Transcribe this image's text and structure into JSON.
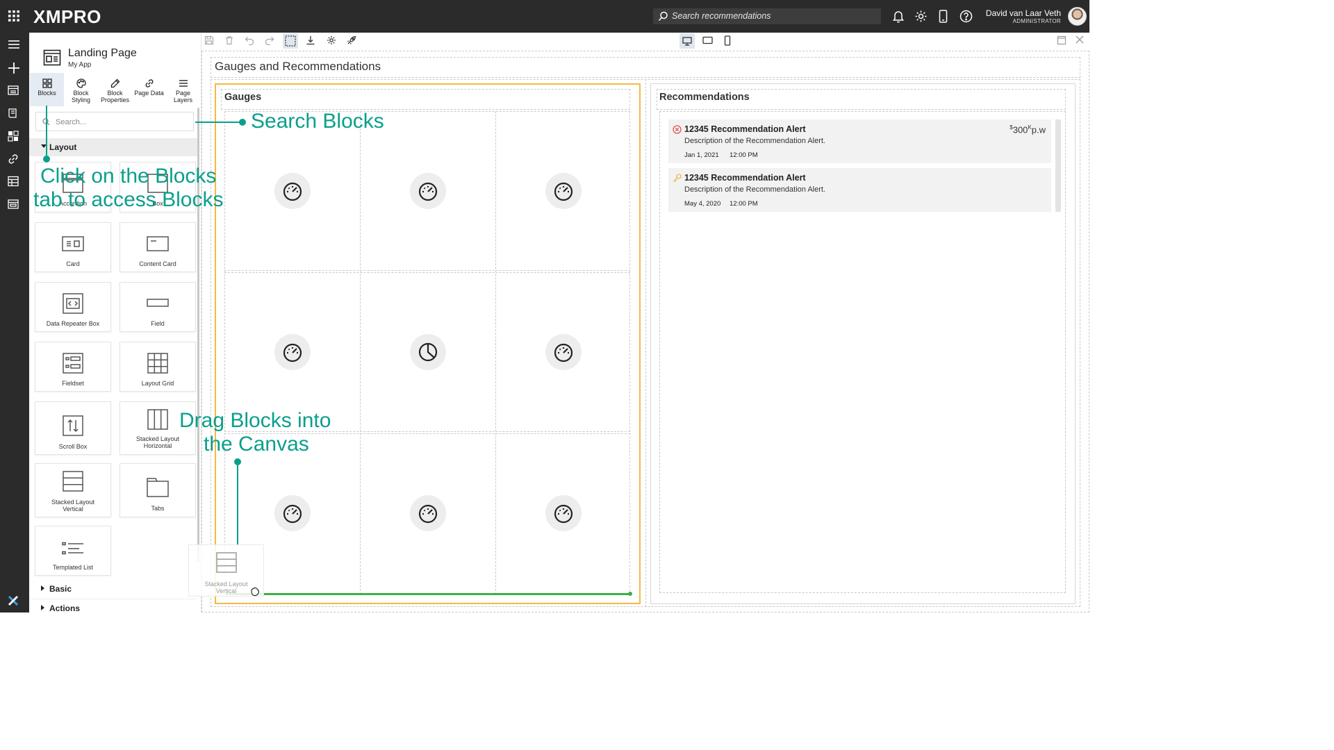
{
  "header": {
    "logo": "XMPRO",
    "search_placeholder": "Search recommendations",
    "user_name": "David van Laar Veth",
    "user_role": "ADMINISTRATOR"
  },
  "rail": {
    "icons": [
      "menu-icon",
      "add-icon",
      "apps-list-icon",
      "book-icon",
      "dashboard-icon",
      "link-icon",
      "table-icon",
      "card-icon"
    ]
  },
  "panel": {
    "page_title": "Landing Page",
    "app_name": "My App",
    "tabs": [
      {
        "label": "Blocks",
        "icon": "blocks-icon"
      },
      {
        "label": "Block Styling",
        "icon": "palette-icon"
      },
      {
        "label": "Block Properties",
        "icon": "pencil-icon"
      },
      {
        "label": "Page Data",
        "icon": "link-icon"
      },
      {
        "label": "Page Layers",
        "icon": "layers-icon"
      }
    ],
    "search_placeholder": "Search...",
    "sections": {
      "layout": "Layout",
      "basic": "Basic",
      "actions": "Actions"
    },
    "tiles": {
      "accordion": "Accordion",
      "box": "Box",
      "card": "Card",
      "content_card": "Content Card",
      "data_repeater": "Data Repeater Box",
      "field": "Field",
      "fieldset": "Fieldset",
      "layout_grid": "Layout Grid",
      "scroll_box": "Scroll Box",
      "stacked_h": "Stacked Layout Horizontal",
      "stacked_v": "Stacked Layout Vertical",
      "tabs": "Tabs",
      "templated_list": "Templated List"
    }
  },
  "canvas": {
    "page_heading": "Gauges and Recommendations",
    "gauges_title": "Gauges",
    "recommendations_title": "Recommendations",
    "recommendations": [
      {
        "title": "12345 Recommendation Alert",
        "description": "Description of the Recommendation Alert.",
        "date": "Jan 1, 2021",
        "time": "12:00 PM",
        "price_prefix": "$",
        "price": "300",
        "price_k": "K",
        "price_suffix": "p.w",
        "status": "error",
        "status_color": "#e25454"
      },
      {
        "title": "12345 Recommendation Alert",
        "description": "Description of the Recommendation Alert.",
        "date": "May 4, 2020",
        "time": "12:00 PM",
        "status": "pending",
        "status_color": "#e9b949"
      }
    ],
    "drag_ghost_label": "Stacked Layout Vertical"
  },
  "annotations": {
    "search": "Search Blocks",
    "blocks_line1": "Click on the Blocks",
    "blocks_line2": "tab to access Blocks",
    "drag_line1": "Drag Blocks into",
    "drag_line2": "the Canvas",
    "color": "#0a9f8c"
  },
  "colors": {
    "header_bg": "#2b2b2b",
    "selection_border": "#f5b942",
    "drop_indicator": "#3cb043"
  }
}
